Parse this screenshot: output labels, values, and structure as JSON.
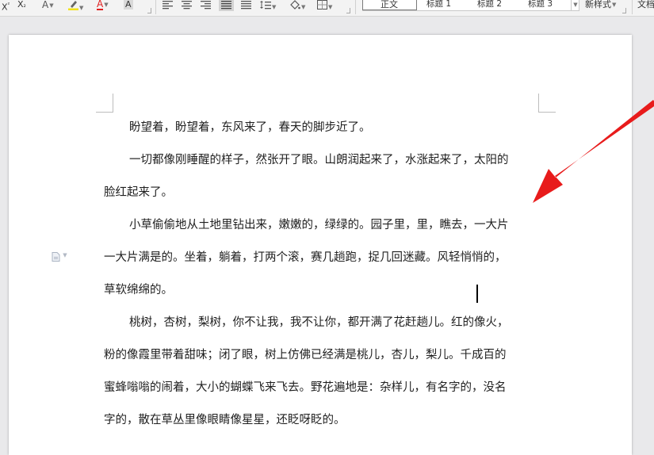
{
  "ribbon": {
    "superscript_label": "X",
    "superscript_mark": "²",
    "subscript_label": "X",
    "subscript_mark": "₂",
    "clear_format_icon_text": "A",
    "char_shading_label": "A",
    "styles": [
      "正文",
      "标题 1",
      "标题 2",
      "标题 3"
    ],
    "new_style_label": "新样式",
    "document_tools_label": "文档"
  },
  "document": {
    "paragraphs": [
      [
        "盼望着，盼望着，东风来了，春天的脚步近了。"
      ],
      [
        "一切都像刚睡醒的样子，然张开了眼。山朗润起来了，水涨起来了，太阳的",
        "脸红起来了。"
      ],
      [
        "小草偷偷地从土地里钻出来，嫩嫩的，绿绿的。园子里，里，瞧去，一大片",
        "一大片满是的。坐着，躺着，打两个滚，赛几趟跑，捉几回迷藏。风轻悄悄的，",
        "草软绵绵的。"
      ],
      [
        "桃树，杏树，梨树，你不让我，我不让你，都开满了花赶趟儿。红的像火，",
        "粉的像霞里带着甜味；闭了眼，树上仿佛已经满是桃儿，杏儿，梨儿。千成百的",
        "蜜蜂嗡嗡的闹着，大小的蝴蝶飞来飞去。野花遍地是：杂样儿，有名字的，没名",
        "字的，散在草丛里像眼睛像星星，还眨呀眨的。"
      ]
    ]
  },
  "colors": {
    "annotation_arrow": "#e81b1b",
    "highlight_yellow": "#f2e21a",
    "font_color_red": "#e02020"
  }
}
